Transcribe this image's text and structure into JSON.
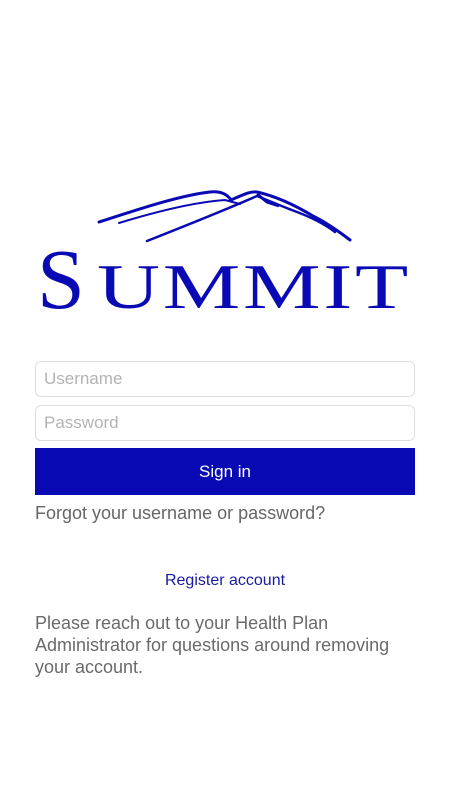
{
  "app": {
    "logo_text": "Summit",
    "logo_initial": "S",
    "logo_rest": "UMMIT"
  },
  "colors": {
    "brand": "#0a0ab4",
    "link": "#1a1aa0",
    "muted_text": "#666666"
  },
  "login": {
    "username_placeholder": "Username",
    "username_value": "",
    "password_placeholder": "Password",
    "password_value": "",
    "signin_label": "Sign in",
    "forgot_label": "Forgot your username or password?",
    "register_label": "Register account"
  },
  "footer": {
    "note": "Please reach out to your Health Plan Administrator for questions around removing your account."
  },
  "icons": {
    "logo": "mountain-logo-icon"
  }
}
